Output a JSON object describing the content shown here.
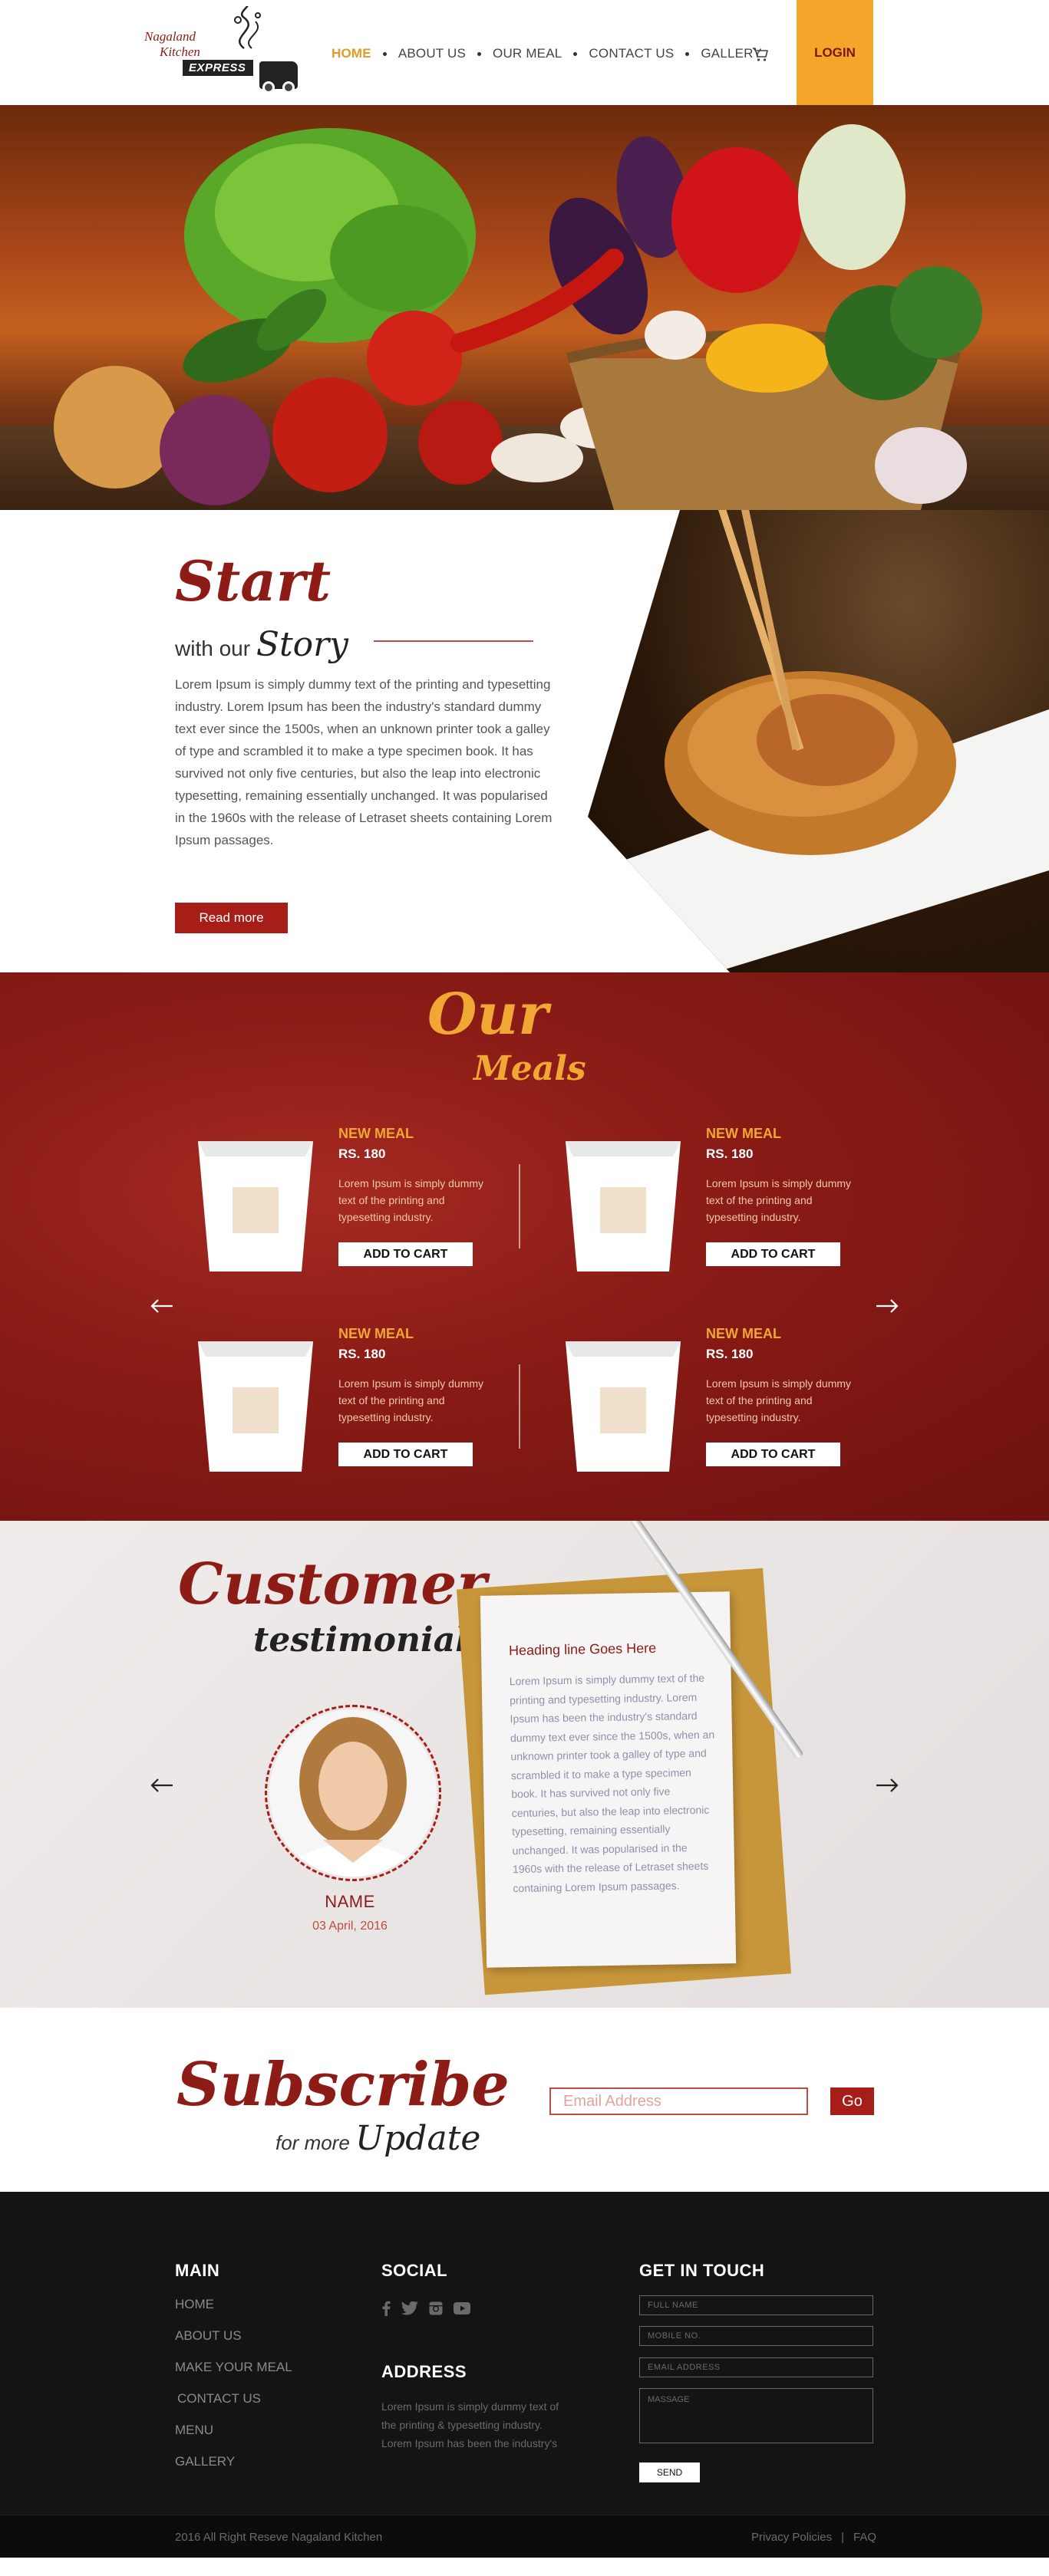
{
  "brand": {
    "logo_line1": "Nagaland",
    "logo_line2": "Kitchen",
    "logo_line3": "EXPRESS"
  },
  "nav": {
    "items": [
      {
        "label": "HOME",
        "active": true
      },
      {
        "label": "ABOUT US",
        "active": false
      },
      {
        "label": "OUR MEAL",
        "active": false
      },
      {
        "label": "CONTACT US",
        "active": false
      },
      {
        "label": "GALLERY",
        "active": false
      }
    ],
    "cart_icon": "cart-icon",
    "login_label": "LOGIN"
  },
  "story": {
    "title": "Start",
    "with_our": "with our",
    "subtitle": "Story",
    "body": "Lorem Ipsum is simply dummy text of the printing and typesetting industry. Lorem Ipsum has been the industry's standard dummy text ever since the 1500s, when an unknown printer took a galley of type and scrambled it to make a type specimen book. It has survived not only five centuries, but also the leap into electronic typesetting, remaining essentially unchanged. It was popularised in the 1960s with the release of Letraset sheets containing Lorem Ipsum passages.",
    "read_more": "Read more"
  },
  "meals": {
    "title_our": "Our",
    "title_meals": "Meals",
    "items": [
      {
        "name": "NEW MEAL",
        "price": "RS. 180",
        "desc": "Lorem Ipsum is simply dummy text of the printing and typesetting industry.",
        "cta": "ADD TO CART"
      },
      {
        "name": "NEW MEAL",
        "price": "RS. 180",
        "desc": "Lorem Ipsum is simply dummy text of the printing and typesetting industry.",
        "cta": "ADD TO CART"
      },
      {
        "name": "NEW MEAL",
        "price": "RS. 180",
        "desc": "Lorem Ipsum is simply dummy text of the printing and typesetting industry.",
        "cta": "ADD TO CART"
      },
      {
        "name": "NEW MEAL",
        "price": "RS. 180",
        "desc": "Lorem Ipsum is simply dummy text of the printing and typesetting industry.",
        "cta": "ADD TO CART"
      }
    ],
    "prev_icon": "arrow-left-icon",
    "next_icon": "arrow-right-icon"
  },
  "testimonials": {
    "title": "Customer",
    "subtitle": "testimonials",
    "heading": "Heading line Goes Here",
    "body": "Lorem Ipsum is simply dummy text of the printing and typesetting industry. Lorem Ipsum has been the industry's standard dummy text ever since the 1500s, when an unknown printer took a galley of type and scrambled it to make a type specimen book. It has survived not only five centuries, but also the leap into electronic typesetting, remaining essentially unchanged. It was popularised in the 1960s with the release of Letraset sheets containing Lorem Ipsum passages.",
    "name": "NAME",
    "date": "03 April, 2016"
  },
  "subscribe": {
    "title": "Subscribe",
    "for_more": "for more",
    "update": "Update",
    "email_placeholder": "Email Address",
    "go_label": "Go"
  },
  "footer": {
    "main_heading": "MAIN",
    "main_links": [
      "HOME",
      "ABOUT US",
      "MAKE YOUR MEAL",
      "CONTACT US",
      "MENU",
      "GALLERY"
    ],
    "social_heading": "SOCIAL",
    "social_icons": [
      "facebook-icon",
      "twitter-icon",
      "instagram-icon",
      "youtube-icon"
    ],
    "address_heading": "ADDRESS",
    "address_text": "Lorem Ipsum is simply dummy text of the printing & typesetting industry. Lorem Ipsum has been the industry's",
    "contact_heading": "GET IN TOUCH",
    "full_name_placeholder": "FULL NAME",
    "mobile_placeholder": "MOBILE NO.",
    "email_placeholder": "EMAIL ADDRESS",
    "message_placeholder": "MASSAGE",
    "send_label": "SEND"
  },
  "bottom": {
    "copyright": "2016 All Right Reseve Nagaland Kitchen",
    "privacy": "Privacy Policies",
    "separator": "|",
    "faq": "FAQ"
  },
  "colors": {
    "brand_red": "#8d1b16",
    "button_red": "#a71d17",
    "accent_orange": "#f4a62a",
    "meals_bg": "#8a1b16",
    "footer_bg": "#141414"
  }
}
